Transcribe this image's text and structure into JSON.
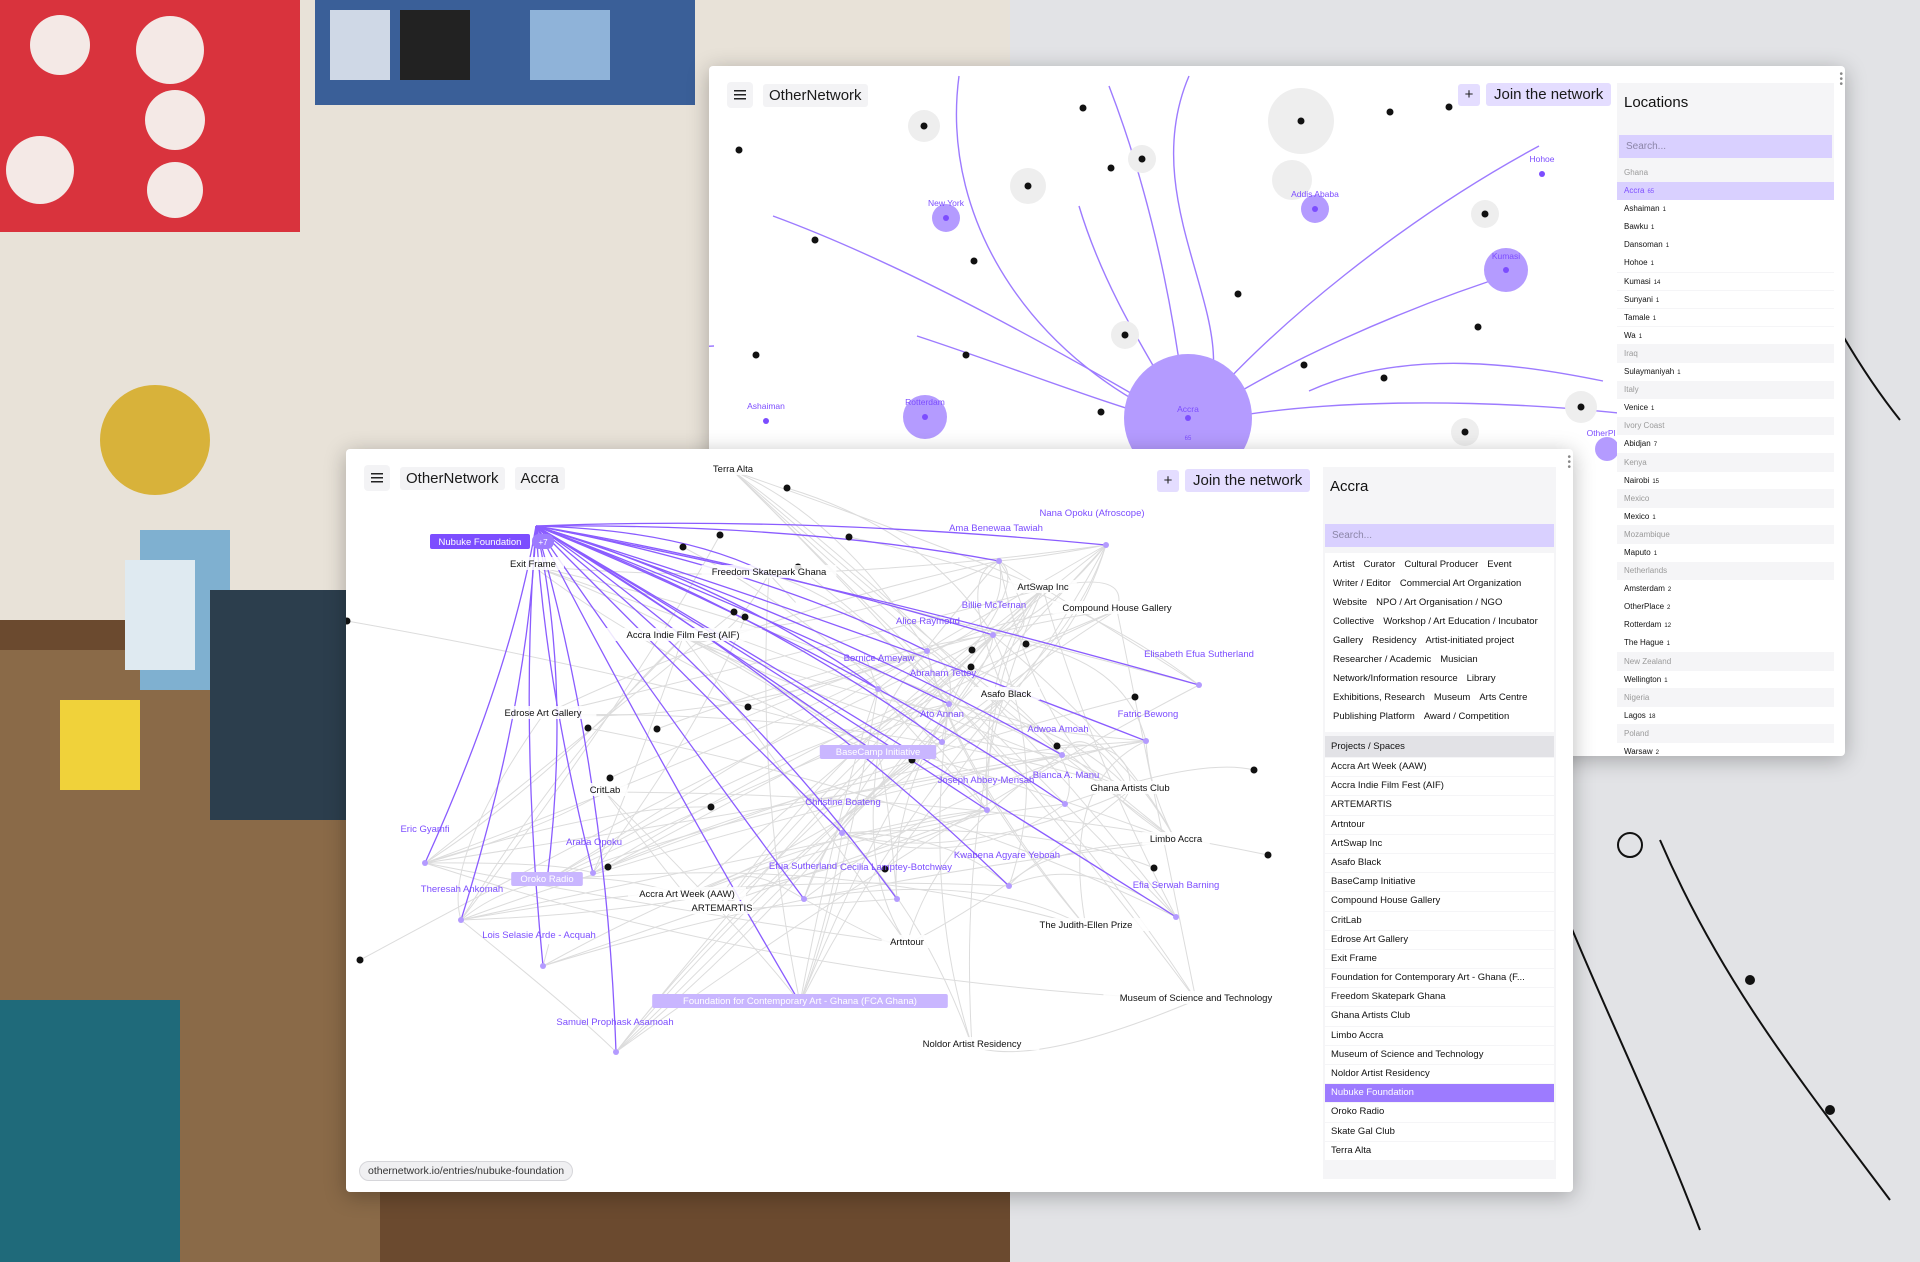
{
  "brand": "OtherNetwork",
  "join_label": "Join the network",
  "plus_label": "+",
  "back_window": {
    "panel_title": "Locations",
    "search_placeholder": "Search...",
    "locations": [
      {
        "name": "Ghana",
        "type": "country"
      },
      {
        "name": "Accra",
        "count": "65",
        "selected": true
      },
      {
        "name": "Ashaiman",
        "count": "1"
      },
      {
        "name": "Bawku",
        "count": "1"
      },
      {
        "name": "Dansoman",
        "count": "1"
      },
      {
        "name": "Hohoe",
        "count": "1"
      },
      {
        "name": "Kumasi",
        "count": "14"
      },
      {
        "name": "Sunyani",
        "count": "1"
      },
      {
        "name": "Tamale",
        "count": "1"
      },
      {
        "name": "Wa",
        "count": "1"
      },
      {
        "name": "Iraq",
        "type": "country"
      },
      {
        "name": "Sulaymaniyah",
        "count": "1"
      },
      {
        "name": "Italy",
        "type": "country"
      },
      {
        "name": "Venice",
        "count": "1"
      },
      {
        "name": "Ivory Coast",
        "type": "country"
      },
      {
        "name": "Abidjan",
        "count": "7"
      },
      {
        "name": "Kenya",
        "type": "country"
      },
      {
        "name": "Nairobi",
        "count": "15"
      },
      {
        "name": "Mexico",
        "type": "country"
      },
      {
        "name": "Mexico",
        "count": "1"
      },
      {
        "name": "Mozambique",
        "type": "country"
      },
      {
        "name": "Maputo",
        "count": "1"
      },
      {
        "name": "Netherlands",
        "type": "country"
      },
      {
        "name": "Amsterdam",
        "count": "2"
      },
      {
        "name": "OtherPlace",
        "count": "2"
      },
      {
        "name": "Rotterdam",
        "count": "12"
      },
      {
        "name": "The Hague",
        "count": "1"
      },
      {
        "name": "New Zealand",
        "type": "country"
      },
      {
        "name": "Wellington",
        "count": "1"
      },
      {
        "name": "Nigeria",
        "type": "country"
      },
      {
        "name": "Lagos",
        "count": "18"
      },
      {
        "name": "Poland",
        "type": "country"
      },
      {
        "name": "Warsaw",
        "count": "2"
      }
    ],
    "graph_labels": {
      "new_york": "New York",
      "addis_ababa": "Addis Ababa",
      "hohoe": "Hohoe",
      "kumasi": "Kumasi",
      "ashaiman": "Ashaiman",
      "rotterdam": "Rotterdam",
      "accra": "Accra",
      "accra_count": "65",
      "otherplace": "OtherPl"
    }
  },
  "front_window": {
    "breadcrumb": "Accra",
    "panel_title": "Accra",
    "search_placeholder": "Search...",
    "tags": [
      "Artist",
      "Curator",
      "Cultural Producer",
      "Event",
      "Writer / Editor",
      "Commercial Art Organization",
      "Website",
      "NPO / Art Organisation / NGO",
      "Collective",
      "Workshop / Art Education / Incubator",
      "Gallery",
      "Residency",
      "Artist-initiated project",
      "Researcher / Academic",
      "Musician",
      "Network/Information resource",
      "Library",
      "Exhibitions, Research",
      "Museum",
      "Arts Centre",
      "Publishing Platform",
      "Award / Competition"
    ],
    "section_title": "Projects / Spaces",
    "projects": [
      "Accra Art Week (AAW)",
      "Accra Indie Film Fest (AIF)",
      "ARTEMARTIS",
      "Artntour",
      "ArtSwap Inc",
      "Asafo Black",
      "BaseCamp Initiative",
      "Compound House Gallery",
      "CritLab",
      "Edrose Art Gallery",
      "Exit Frame",
      "Foundation for Contemporary Art - Ghana (F...",
      "Freedom Skatepark Ghana",
      "Ghana Artists Club",
      "Limbo Accra",
      "Museum of Science and Technology",
      "Noldor Artist Residency",
      "Nubuke Foundation",
      "Oroko Radio",
      "Skate Gal Club",
      "Terra Alta"
    ],
    "selected_project": "Nubuke Foundation",
    "url": "othernetwork.io/entries/nubuke-foundation",
    "selected_node": "Nubuke Foundation",
    "selected_badge": "+7",
    "graph_labels": {
      "terra_alta": "Terra Alta",
      "exit_frame": "Exit Frame",
      "freedom": "Freedom Skatepark Ghana",
      "artswap": "ArtSwap Inc",
      "compound": "Compound House Gallery",
      "aif": "Accra Indie Film Fest (AIF)",
      "asafo": "Asafo Black",
      "edrose": "Edrose Art Gallery",
      "critlab": "CritLab",
      "ghana_artists": "Ghana Artists Club",
      "limbo": "Limbo Accra",
      "aaw": "Accra Art Week (AAW)",
      "artemartis": "ARTEMARTIS",
      "judith": "The Judith-Ellen Prize",
      "artntour": "Artntour",
      "museum": "Museum of Science and Technology",
      "noldor": "Noldor Artist Residency",
      "nana": "Nana Opoku (Afroscope)",
      "ama": "Ama Benewaa Tawiah",
      "billie": "Billie McTernan",
      "alice": "Alice Raymond",
      "elisabeth": "Elisabeth Efua Sutherland",
      "bernice": "Bernice Ameyaw",
      "abraham": "Abraham Tettey",
      "ato": "Ato Annan",
      "fatric": "Fatric Bewong",
      "adwoa": "Adwoa Amoah",
      "basecamp": "BaseCamp Initiative",
      "joseph": "Joseph Abbey-Mensah",
      "bianca": "Bianca A. Manu",
      "christine": "Christine Boateng",
      "eric": "Eric Gyamfi",
      "araba": "Araba Opoku",
      "kwabena": "Kwabena Agyare Yeboah",
      "efua": "Efua Sutherland",
      "cecilia": "Cecilia Lamptey-Botchway",
      "efia": "Efia Serwah Barning",
      "theresah": "Theresah Ankomah",
      "oroko": "Oroko Radio",
      "lois": "Lois Selasie Arde - Acquah",
      "fca": "Foundation for Contemporary Art - Ghana (FCA Ghana)",
      "samuel": "Samuel Prophask Asamoah"
    }
  },
  "colors": {
    "accent": "#7c4dff",
    "accent_light": "#d9d0ff",
    "node_fill": "#b9a4ff",
    "edge_gray": "#dcdcdc",
    "selected_edge": "#8a5cff"
  },
  "icons": [
    "menu-icon",
    "plus-icon",
    "more-icon"
  ]
}
